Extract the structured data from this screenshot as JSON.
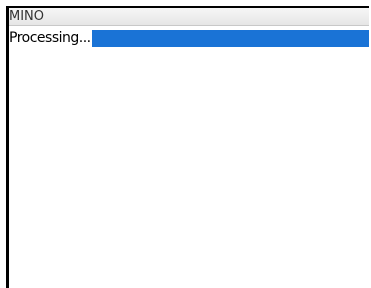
{
  "window": {
    "title": "MINO"
  },
  "status": {
    "text": "Processing...",
    "progress": 1.0,
    "progress_color": "#1a73d6"
  }
}
